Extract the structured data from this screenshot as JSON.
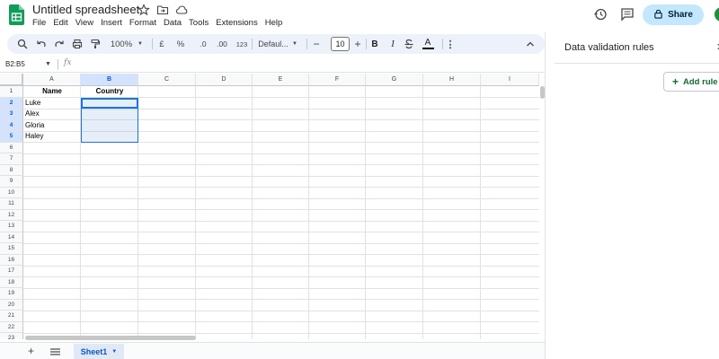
{
  "app": {
    "title": "Untitled spreadsheet",
    "menu": [
      "File",
      "Edit",
      "View",
      "Insert",
      "Format",
      "Data",
      "Tools",
      "Extensions",
      "Help"
    ],
    "share_label": "Share"
  },
  "toolbar": {
    "zoom": "100%",
    "currency": "£",
    "percent": "%",
    "decrease_decimal": ".0",
    "increase_decimal": ".00",
    "number_format": "123",
    "font": "Defaul...",
    "font_size": "10",
    "bold": "B",
    "italic": "I",
    "text_color": "A"
  },
  "formula_bar": {
    "name_box": "B2:B5",
    "fx_label": "fx"
  },
  "grid": {
    "columns": [
      "A",
      "B",
      "C",
      "D",
      "E",
      "F",
      "G",
      "H",
      "I"
    ],
    "selected_column": "B",
    "rows": [
      "1",
      "2",
      "3",
      "4",
      "5",
      "6",
      "7",
      "8",
      "9",
      "10",
      "11",
      "12",
      "13",
      "14",
      "15",
      "16",
      "17",
      "18",
      "19",
      "20",
      "21",
      "22",
      "23"
    ],
    "selected_rows": [
      "2",
      "3",
      "4",
      "5"
    ],
    "cells": {
      "A1": "Name",
      "B1": "Country",
      "A2": "Luke",
      "A3": "Alex",
      "A4": "Gloria",
      "A5": "Haley"
    }
  },
  "sheets": {
    "active": "Sheet1"
  },
  "panel": {
    "title": "Data validation rules",
    "add_rule_label": "Add rule"
  },
  "colors": {
    "accent": "#0b57d0",
    "share_bg": "#c2e7ff",
    "toolbar_bg": "#edf2fa",
    "add_rule_text": "#146c2e"
  }
}
